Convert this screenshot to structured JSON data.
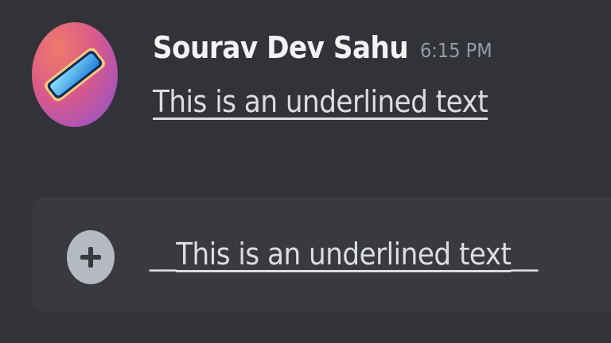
{
  "message": {
    "author": "Sourav Dev Sahu",
    "timestamp": "6:15 PM",
    "text": "This is an underlined text",
    "avatar_icon": "phone-icon",
    "avatar_colors": [
      "#f07a6b",
      "#d95a8a",
      "#8a4fd6"
    ]
  },
  "composer": {
    "add_icon": "plus-circle-icon",
    "prefix": "__",
    "text": "This is an underlined text",
    "suffix": "__"
  },
  "colors": {
    "background": "#313338",
    "composer_bg": "#383a40",
    "username": "#f2f3f5",
    "timestamp": "#949ba4",
    "text": "#dbdee1"
  }
}
